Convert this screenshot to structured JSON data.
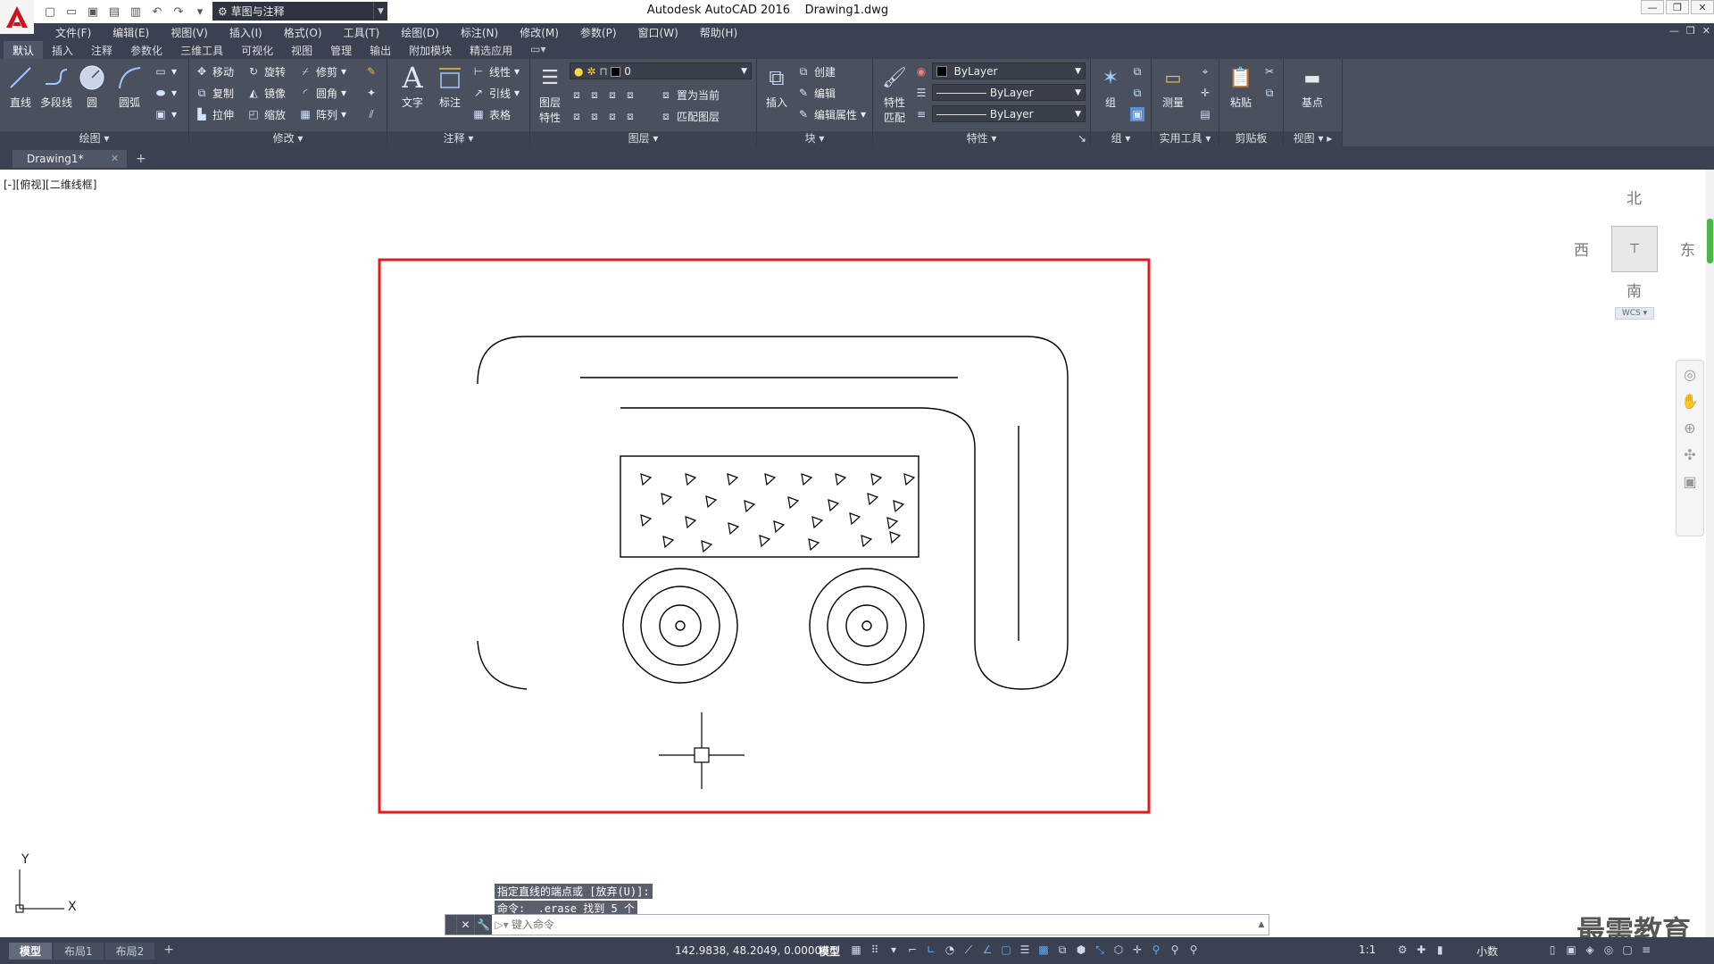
{
  "titlebar": {
    "title": "Autodesk AutoCAD 2016",
    "filename": "Drawing1.dwg",
    "workspace": "草图与注释"
  },
  "menubar": {
    "items": [
      "文件(F)",
      "编辑(E)",
      "视图(V)",
      "插入(I)",
      "格式(O)",
      "工具(T)",
      "绘图(D)",
      "标注(N)",
      "修改(M)",
      "参数(P)",
      "窗口(W)",
      "帮助(H)"
    ]
  },
  "ribbon_tabs": [
    "默认",
    "插入",
    "注释",
    "参数化",
    "三维工具",
    "可视化",
    "视图",
    "管理",
    "输出",
    "附加模块",
    "精选应用"
  ],
  "ribbon": {
    "draw": {
      "title": "绘图",
      "line": "直线",
      "polyline": "多段线",
      "circle": "圆",
      "arc": "圆弧"
    },
    "modify": {
      "title": "修改",
      "move": "移动",
      "rotate": "旋转",
      "trim": "修剪",
      "copy": "复制",
      "mirror": "镜像",
      "fillet": "圆角",
      "stretch": "拉伸",
      "scale": "缩放",
      "array": "阵列"
    },
    "annotation": {
      "title": "注释",
      "text": "文字",
      "dimension": "标注",
      "linear": "线性",
      "leader": "引线",
      "table": "表格"
    },
    "layers": {
      "title": "图层",
      "properties_line1": "图层",
      "properties_line2": "特性",
      "layer_name": "0",
      "set_current": "置为当前",
      "match_layer": "匹配图层"
    },
    "block": {
      "title": "块",
      "insert": "插入",
      "create": "创建",
      "edit": "编辑",
      "edit_attributes": "编辑属性"
    },
    "properties": {
      "title": "特性",
      "match_line1": "特性",
      "match_line2": "匹配",
      "color": "ByLayer",
      "linetype": "ByLayer",
      "lineweight": "ByLayer"
    },
    "groups": {
      "title": "组",
      "group": "组"
    },
    "utilities": {
      "title": "实用工具",
      "measure": "测量"
    },
    "clipboard": {
      "title": "剪贴板",
      "paste": "粘贴"
    },
    "view": {
      "title": "视图",
      "base": "基点"
    }
  },
  "filetab": {
    "name": "Drawing1*"
  },
  "viewport": {
    "label": "[-][俯视][二维线框]"
  },
  "viewcube": {
    "north": "北",
    "south": "南",
    "east": "东",
    "west": "西",
    "wcs": "WCS"
  },
  "ucs": {
    "x": "X",
    "y": "Y"
  },
  "command": {
    "history": [
      "指定直线的端点或 [放弃(U)]:",
      "命令: _.erase 找到 5 个"
    ],
    "placeholder": "键入命令"
  },
  "watermark": "最需教育",
  "statusbar": {
    "layouts": [
      "模型",
      "布局1",
      "布局2"
    ],
    "coordinates": "142.9838, 48.2049, 0.0000",
    "mode": "模型",
    "scale": "1:1",
    "units": "小数"
  },
  "colors": {
    "highlight_frame": "#e8191e",
    "ribbon_bg": "#4a505d",
    "statusbar_bg": "#3b4150"
  }
}
